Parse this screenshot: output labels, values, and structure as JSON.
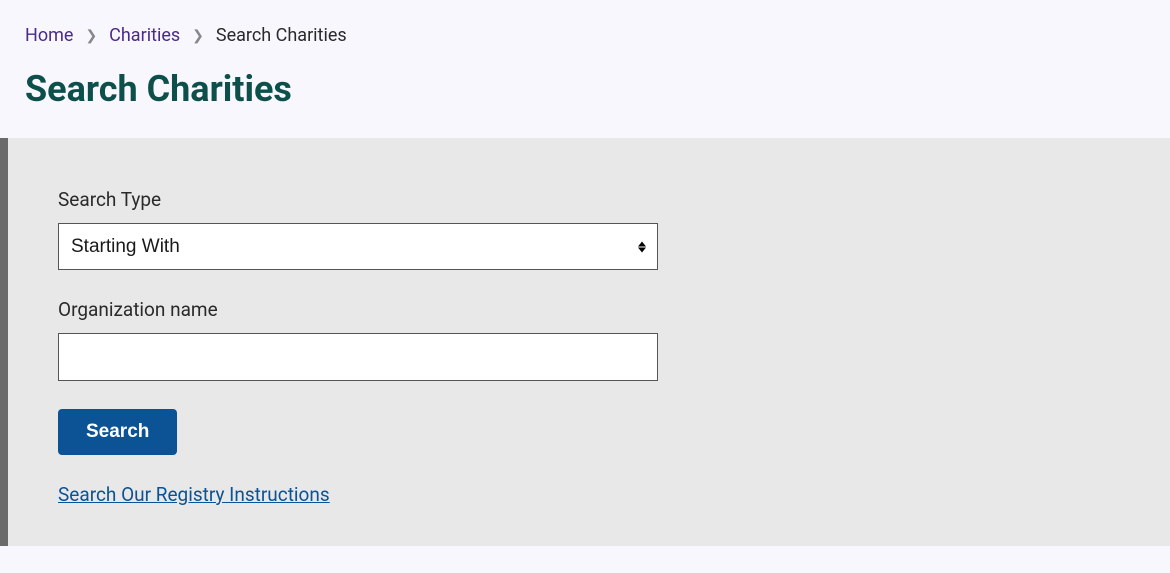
{
  "breadcrumb": {
    "home": "Home",
    "charities": "Charities",
    "current": "Search Charities"
  },
  "page_title": "Search Charities",
  "form": {
    "search_type_label": "Search Type",
    "search_type_value": "Starting With",
    "org_name_label": "Organization name",
    "org_name_value": "",
    "submit_label": "Search",
    "instructions_link": "Search Our Registry Instructions"
  }
}
